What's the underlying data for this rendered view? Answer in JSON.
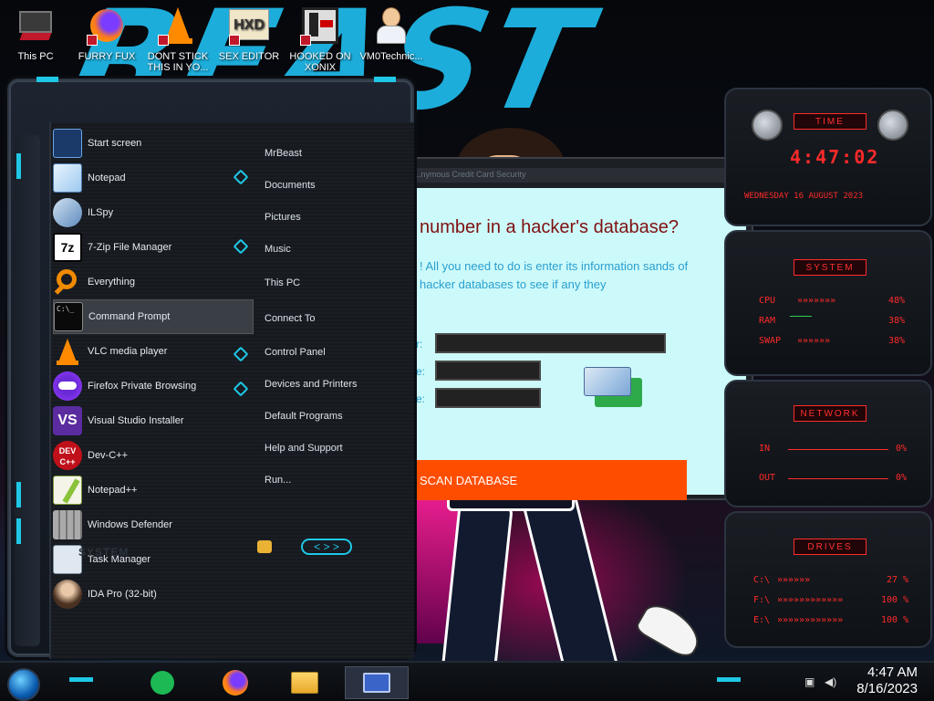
{
  "desktop_icons": [
    {
      "label": "This PC"
    },
    {
      "label": "FURRY FUX"
    },
    {
      "label": "DONT STICK THIS IN YO..."
    },
    {
      "label": "SEX EDITOR"
    },
    {
      "label": "HOOKED ON XONIX"
    },
    {
      "label": "VM0Technic..."
    }
  ],
  "wallpaper": {
    "word": "BEAST"
  },
  "start_menu": {
    "apps": [
      {
        "label": "Start screen",
        "icon": "start-screen-icon"
      },
      {
        "label": "Notepad",
        "icon": "notepad-icon"
      },
      {
        "label": "ILSpy",
        "icon": "ilspy-icon"
      },
      {
        "label": "7-Zip File Manager",
        "icon": "7zip-icon"
      },
      {
        "label": "Everything",
        "icon": "search-icon"
      },
      {
        "label": "Command Prompt",
        "icon": "cmd-icon"
      },
      {
        "label": "VLC media player",
        "icon": "vlc-icon"
      },
      {
        "label": "Firefox Private Browsing",
        "icon": "firefox-private-icon"
      },
      {
        "label": "Visual Studio Installer",
        "icon": "visual-studio-icon"
      },
      {
        "label": "Dev-C++",
        "icon": "devcpp-icon"
      },
      {
        "label": "Notepad++",
        "icon": "notepadpp-icon"
      },
      {
        "label": "Windows Defender",
        "icon": "defender-icon"
      },
      {
        "label": "Task Manager",
        "icon": "task-manager-icon"
      },
      {
        "label": "IDA Pro (32-bit)",
        "icon": "ida-icon"
      }
    ],
    "places": [
      "MrBeast",
      "Documents",
      "Pictures",
      "Music",
      "This PC",
      "Connect To",
      "Control Panel",
      "Devices and Printers",
      "Default Programs",
      "Help and Support",
      "Run..."
    ],
    "bottom_label": "SYSTEM",
    "arrows": "< > >"
  },
  "window": {
    "title": "...nymous Credit Card Security",
    "headline": "number in a hacker's database?",
    "subtext": "! All you need to do is enter its information sands of hacker databases to see if any they",
    "field_labels": [
      "r:",
      "e:",
      "e:"
    ],
    "scan_button": "SCAN DATABASE"
  },
  "gadgets": {
    "time": {
      "title": "TIME",
      "clock": "4:47:02",
      "date": "WEDNESDAY 16 AUGUST 2023"
    },
    "system": {
      "title": "SYSTEM",
      "rows": [
        {
          "label": "CPU",
          "value": "48%"
        },
        {
          "label": "RAM",
          "value": "38%"
        },
        {
          "label": "SWAP",
          "value": "38%"
        }
      ]
    },
    "network": {
      "title": "NETWORK",
      "rows": [
        {
          "label": "IN",
          "value": "0%"
        },
        {
          "label": "OUT",
          "value": "0%"
        }
      ]
    },
    "drives": {
      "title": "DRIVES",
      "rows": [
        {
          "label": "C:\\",
          "value": "27 %"
        },
        {
          "label": "F:\\",
          "value": "100 %"
        },
        {
          "label": "E:\\",
          "value": "100 %"
        }
      ]
    }
  },
  "taskbar": {
    "time": "4:47 AM",
    "date": "8/16/2023"
  },
  "colors": {
    "accent": "#1ec8e6",
    "alert": "#ff2a2a",
    "scan": "#ff4d00"
  }
}
